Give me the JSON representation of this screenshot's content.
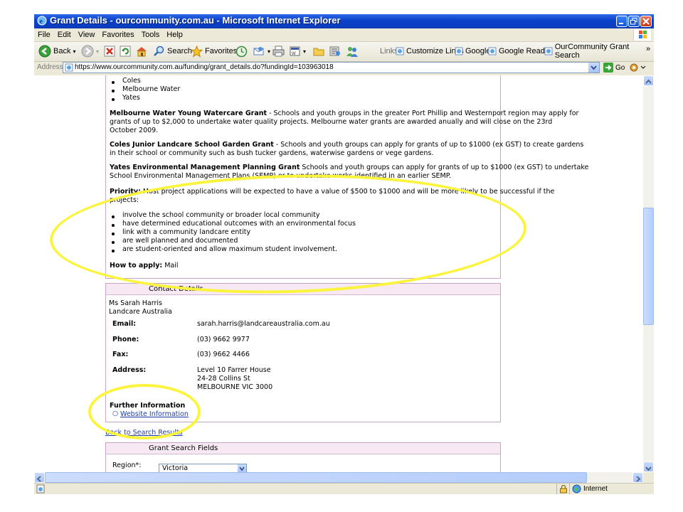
{
  "window": {
    "title": "Grant Details - ourcommunity.com.au - Microsoft Internet Explorer"
  },
  "menu": [
    "File",
    "Edit",
    "View",
    "Favorites",
    "Tools",
    "Help"
  ],
  "toolbar": {
    "back": "Back",
    "search": "Search",
    "favorites": "Favorites",
    "links_label": "Links",
    "links": [
      "Customize Links",
      "Google",
      "Google Reader",
      "OurCommunity Grant Search"
    ],
    "overflow": "»"
  },
  "address": {
    "label": "Address",
    "url": "https://www.ourcommunity.com.au/funding/grant_details.do?fundingId=103963018",
    "go": "Go"
  },
  "content": {
    "top_list": [
      "Coles",
      "Melbourne Water",
      "Yates"
    ],
    "grants": [
      {
        "name": "Melbourne Water Young Watercare Grant",
        "line1": " - Schools and youth groups in the greater Port Phillip and Westernport region may apply for",
        "line2": "grants of up to $2,000 to undertake water quality projects. Melbourne water grants are awarded anually and will close on the 23rd",
        "line3": "October 2009."
      },
      {
        "name": "Coles Junior Landcare School Garden Grant",
        "line1": " - Schools and youth groups can apply for grants of up to $1000 (ex GST) to create gardens",
        "line2": "in their school or community such as bush tucker gardens, waterwise gardens or vege gardens."
      },
      {
        "name": "Yates Environmental Management Planning Grant",
        "line1": " Schools and youth groups can apply for grants of up to $1000 (ex GST) to undertake",
        "line2": "School Environmental Management Plans (SEMP) or to undertake works identified in an earlier SEMP."
      }
    ],
    "priority_label": "Priority:",
    "priority_line1": " Most project applications will be expected to have a value of $500 to $1000 and will be more likely to be successful if the",
    "priority_line2": "projects:",
    "priority_items": [
      "involve the school community or broader local community",
      "have determined educational outcomes with an environmental focus",
      "link with a community landcare entity",
      "are well planned and documented",
      "are student-oriented and allow maximum student involvement."
    ],
    "how_label": "How to apply:",
    "how_value": " Mail"
  },
  "contact": {
    "header": "Contact Details",
    "name": "Ms Sarah Harris",
    "org": "Landcare Australia",
    "email_label": "Email:",
    "email": "sarah.harris@landcareaustralia.com.au",
    "phone_label": "Phone:",
    "phone": "(03) 9662 9977",
    "fax_label": "Fax:",
    "fax": "(03) 9662 4466",
    "address_label": "Address:",
    "address_lines": [
      "Level 10 Farrer House",
      "24-28 Collins St",
      "MELBOURNE VIC 3000"
    ],
    "further_label": "Further Information",
    "website_link": "Website Information"
  },
  "back_link": "Back to Search Results",
  "search_fields": {
    "header": "Grant Search Fields",
    "region_label": "Region*:",
    "region_value": "Victoria"
  },
  "status": {
    "zone": "Internet"
  },
  "colors": {
    "panel_border": "#c9a4c9",
    "panel_header": "#f6e9f4",
    "highlight": "#fbf43c",
    "link": "#1f3da7"
  }
}
